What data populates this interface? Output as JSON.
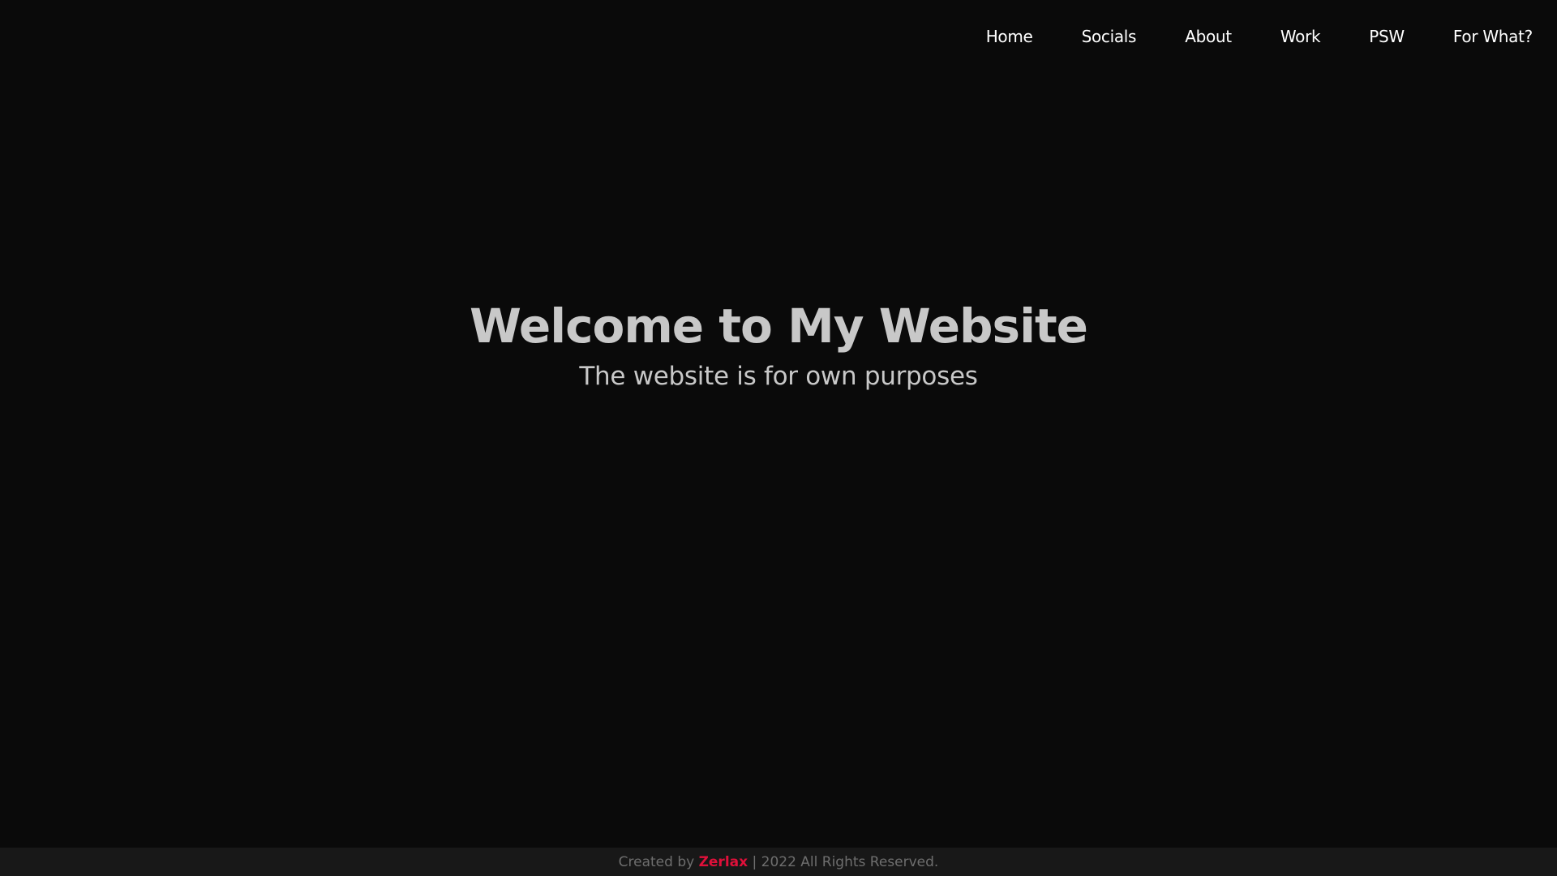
{
  "nav": {
    "items": [
      {
        "label": "Home"
      },
      {
        "label": "Socials"
      },
      {
        "label": "About"
      },
      {
        "label": "Work"
      },
      {
        "label": "PSW"
      },
      {
        "label": "For What?"
      }
    ]
  },
  "hero": {
    "title": "Welcome to My Website",
    "subtitle": "The website is for own purposes"
  },
  "footer": {
    "prefix": "Created by ",
    "brand": "Zerlax",
    "suffix": " | 2022 All Rights Reserved."
  },
  "colors": {
    "background": "#0a0a0a",
    "footer_background": "#181818",
    "accent": "#e0103a",
    "hero_text": "#c8c8c8",
    "nav_text": "#ffffff",
    "footer_text": "#6e6e6e"
  }
}
